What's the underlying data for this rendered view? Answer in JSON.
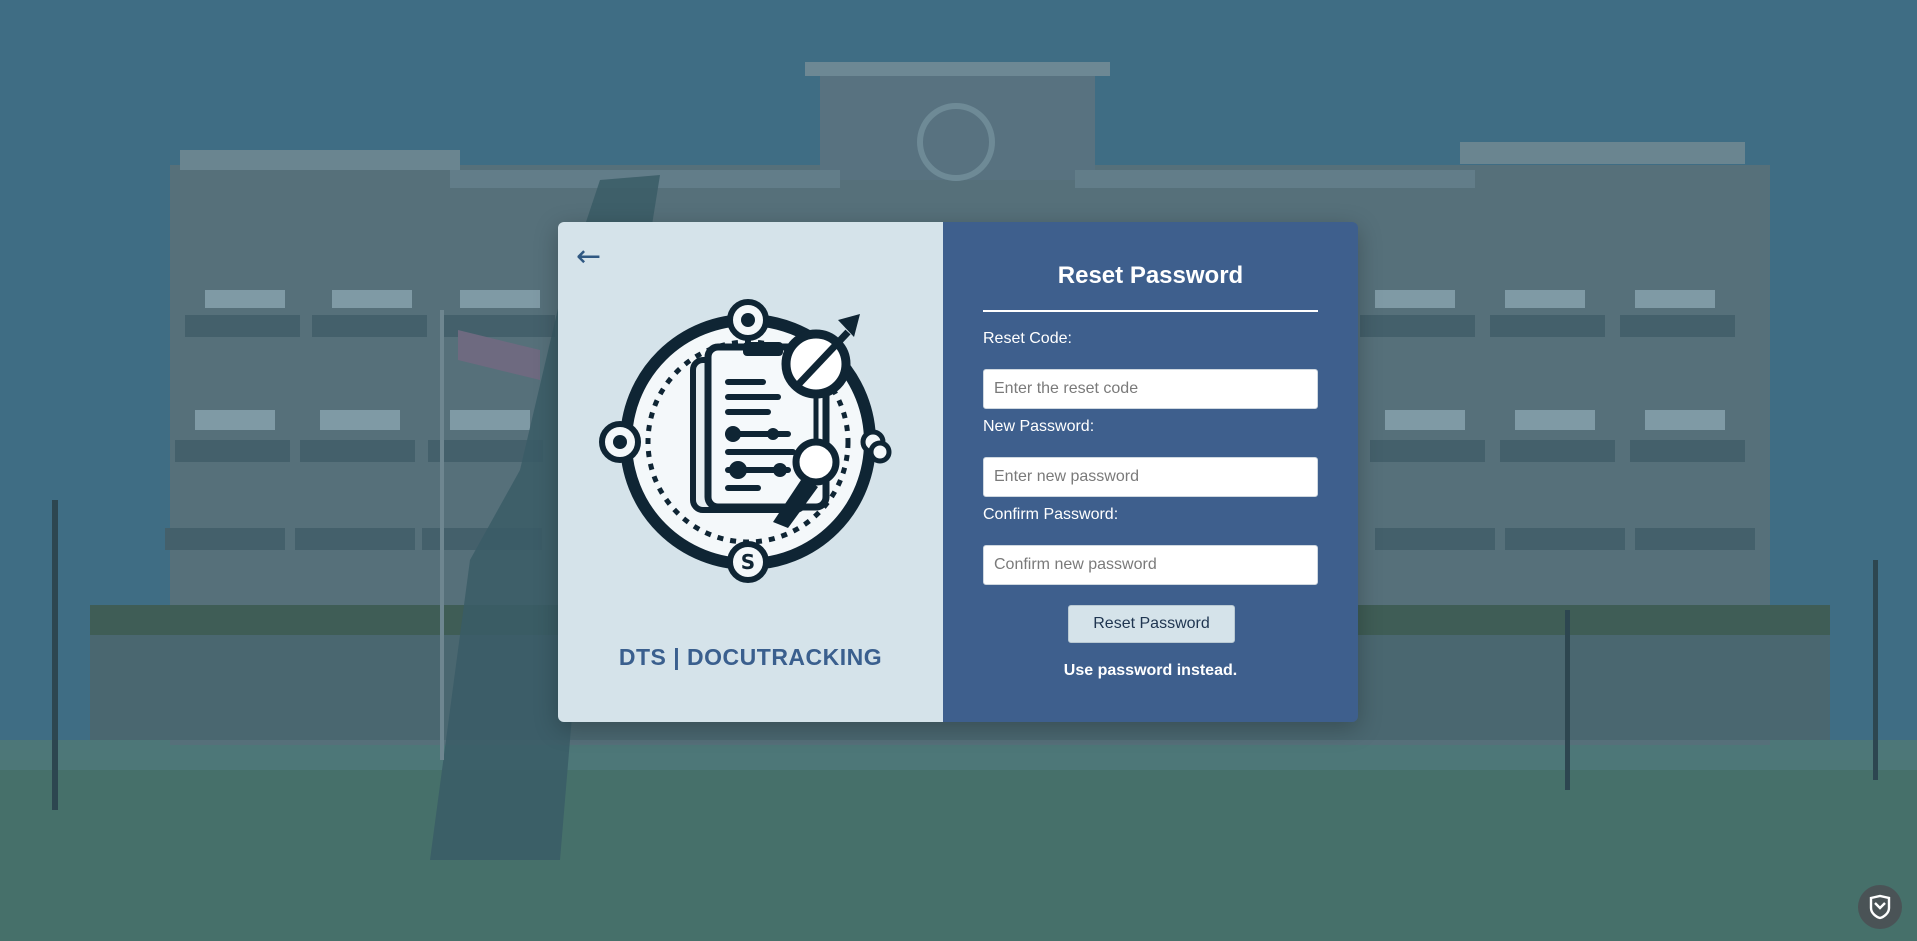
{
  "page": {
    "back_icon": "left-arrow-icon",
    "brand_text": "DTS | DOCUTRACKING",
    "logo_icon": "document-tracking-logo"
  },
  "form": {
    "title": "Reset Password",
    "reset_code_label": "Reset Code:",
    "reset_code_placeholder": "Enter the reset code",
    "reset_code_value": "",
    "new_password_label": "New Password:",
    "new_password_placeholder": "Enter new password",
    "new_password_value": "",
    "confirm_password_label": "Confirm Password:",
    "confirm_password_placeholder": "Confirm new password",
    "confirm_password_value": "",
    "submit_label": "Reset Password",
    "alt_link_label": "Use password instead."
  },
  "colors": {
    "left_panel": "#d5e3ea",
    "right_panel": "#3e5f8d",
    "brand": "#3a5f8e",
    "overlay": "#3f6e85"
  },
  "corner_badge_icon": "shield-badge-icon"
}
